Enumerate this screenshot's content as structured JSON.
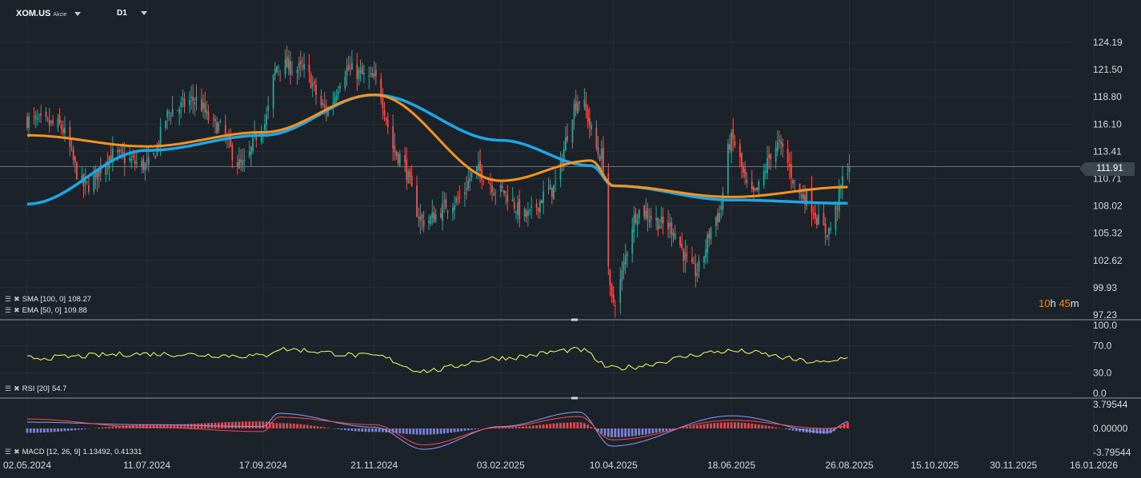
{
  "header": {
    "symbol": "XOM.US",
    "asset_type": "Akcie",
    "timeframe": "D1"
  },
  "indicators": {
    "sma_label": "SMA [100,  0]",
    "sma_value": "108.27",
    "ema_label": "EMA [50,  0]",
    "ema_value": "109.88",
    "rsi_label": "RSI [20]",
    "rsi_value": "54.7",
    "macd_label": "MACD [12,  26,  9]",
    "macd_value": "1.13492,  0.41331"
  },
  "timer": {
    "hours": "10",
    "h": "h",
    "minutes": "45",
    "m": "m"
  },
  "current_price": "111.91",
  "colors": {
    "background": "#1b2229",
    "bull": "#26a69a",
    "bear": "#ef5350",
    "sma": "#1ea7e8",
    "ema": "#f7931e",
    "rsi": "#ffff66",
    "macd_line": "#8e9cff",
    "signal_line": "#ff4b4b",
    "hist_pos": "#e0484f",
    "hist_neg": "#7b83d6"
  },
  "chart_data": {
    "type": "candlestick",
    "title": "XOM.US",
    "x_tick_labels": [
      "02.05.2024",
      "11.07.2024",
      "17.09.2024",
      "21.11.2024",
      "03.02.2025",
      "10.04.2025",
      "18.06.2025",
      "26.08.2025",
      "15.10.2025",
      "30.11.2025",
      "16.01.2026"
    ],
    "price_axis": {
      "tick_labels": [
        "124.19",
        "121.50",
        "118.80",
        "116.10",
        "113.41",
        "110.71",
        "108.02",
        "105.32",
        "102.62",
        "99.93",
        "97.23"
      ],
      "range": [
        97.23,
        125.5
      ]
    },
    "price_key_points": [
      {
        "date": "02.05.2024",
        "close": 116.5
      },
      {
        "date": "20.05.2024",
        "close": 116.0
      },
      {
        "date": "05.06.2024",
        "close": 110.0
      },
      {
        "date": "21.06.2024",
        "close": 113.0
      },
      {
        "date": "11.07.2024",
        "close": 112.0
      },
      {
        "date": "26.07.2024",
        "close": 117.5
      },
      {
        "date": "08.08.2024",
        "close": 118.5
      },
      {
        "date": "20.08.2024",
        "close": 116.0
      },
      {
        "date": "05.09.2024",
        "close": 112.0
      },
      {
        "date": "17.09.2024",
        "close": 116.0
      },
      {
        "date": "26.09.2024",
        "close": 122.0
      },
      {
        "date": "10.10.2024",
        "close": 121.5
      },
      {
        "date": "24.10.2024",
        "close": 117.5
      },
      {
        "date": "05.11.2024",
        "close": 121.5
      },
      {
        "date": "21.11.2024",
        "close": 120.5
      },
      {
        "date": "05.12.2024",
        "close": 113.0
      },
      {
        "date": "20.12.2024",
        "close": 106.5
      },
      {
        "date": "08.01.2025",
        "close": 108.5
      },
      {
        "date": "20.01.2025",
        "close": 111.5
      },
      {
        "date": "03.02.2025",
        "close": 109.5
      },
      {
        "date": "18.02.2025",
        "close": 107.0
      },
      {
        "date": "04.03.2025",
        "close": 109.5
      },
      {
        "date": "21.03.2025",
        "close": 118.5
      },
      {
        "date": "03.04.2025",
        "close": 113.0
      },
      {
        "date": "09.04.2025",
        "close": 98.5
      },
      {
        "date": "25.04.2025",
        "close": 107.5
      },
      {
        "date": "12.05.2025",
        "close": 106.0
      },
      {
        "date": "28.05.2025",
        "close": 101.5
      },
      {
        "date": "10.06.2025",
        "close": 107.0
      },
      {
        "date": "18.06.2025",
        "close": 114.5
      },
      {
        "date": "30.06.2025",
        "close": 109.0
      },
      {
        "date": "15.07.2025",
        "close": 114.0
      },
      {
        "date": "30.07.2025",
        "close": 109.0
      },
      {
        "date": "13.08.2025",
        "close": 105.5
      },
      {
        "date": "26.08.2025",
        "close": 111.91
      }
    ],
    "sma_100": [
      {
        "date": "02.05.2024",
        "value": 108.2
      },
      {
        "date": "11.07.2024",
        "value": 113.5
      },
      {
        "date": "17.09.2024",
        "value": 115.0
      },
      {
        "date": "21.11.2024",
        "value": 119.0
      },
      {
        "date": "03.02.2025",
        "value": 114.5
      },
      {
        "date": "28.03.2025",
        "value": 112.0
      },
      {
        "date": "10.04.2025",
        "value": 110.0
      },
      {
        "date": "18.06.2025",
        "value": 108.6
      },
      {
        "date": "26.08.2025",
        "value": 108.27
      }
    ],
    "ema_50": [
      {
        "date": "02.05.2024",
        "value": 115.0
      },
      {
        "date": "11.07.2024",
        "value": 113.9
      },
      {
        "date": "17.09.2024",
        "value": 115.3
      },
      {
        "date": "21.11.2024",
        "value": 119.0
      },
      {
        "date": "03.02.2025",
        "value": 110.5
      },
      {
        "date": "28.03.2025",
        "value": 112.5
      },
      {
        "date": "10.04.2025",
        "value": 110.0
      },
      {
        "date": "18.06.2025",
        "value": 108.9
      },
      {
        "date": "26.08.2025",
        "value": 109.88
      }
    ],
    "rsi": {
      "period": 20,
      "last": 54.7,
      "tick_labels": [
        "100.0",
        "70.0",
        "30.0",
        "0.0"
      ],
      "key_points": [
        {
          "date": "02.05.2024",
          "value": 52
        },
        {
          "date": "11.07.2024",
          "value": 58
        },
        {
          "date": "17.09.2024",
          "value": 55
        },
        {
          "date": "26.09.2024",
          "value": 65
        },
        {
          "date": "21.11.2024",
          "value": 55
        },
        {
          "date": "20.12.2024",
          "value": 33
        },
        {
          "date": "03.02.2025",
          "value": 52
        },
        {
          "date": "21.03.2025",
          "value": 64
        },
        {
          "date": "09.04.2025",
          "value": 37
        },
        {
          "date": "18.06.2025",
          "value": 62
        },
        {
          "date": "13.08.2025",
          "value": 45
        },
        {
          "date": "26.08.2025",
          "value": 54.7
        }
      ]
    },
    "macd": {
      "params": [
        12,
        26,
        9
      ],
      "macd_last": 1.13492,
      "signal_last": 0.41331,
      "tick_labels": [
        "3.79544",
        "0.00000",
        "-3.79544"
      ],
      "key_points": [
        {
          "date": "02.05.2024",
          "macd": 1.0,
          "signal": 1.5
        },
        {
          "date": "11.07.2024",
          "macd": 0.6,
          "signal": 0.2
        },
        {
          "date": "17.09.2024",
          "macd": 0.3,
          "signal": -0.5
        },
        {
          "date": "26.09.2024",
          "macd": 2.4,
          "signal": 1.8
        },
        {
          "date": "21.11.2024",
          "macd": 0.2,
          "signal": 0.6
        },
        {
          "date": "20.12.2024",
          "macd": -3.3,
          "signal": -2.6
        },
        {
          "date": "03.02.2025",
          "macd": 0.3,
          "signal": 0.2
        },
        {
          "date": "21.03.2025",
          "macd": 2.6,
          "signal": 1.9
        },
        {
          "date": "09.04.2025",
          "macd": -2.8,
          "signal": -1.8
        },
        {
          "date": "18.06.2025",
          "macd": 2.0,
          "signal": 1.3
        },
        {
          "date": "13.08.2025",
          "macd": -0.6,
          "signal": 0.0
        },
        {
          "date": "26.08.2025",
          "macd": 1.13492,
          "signal": 0.41331
        }
      ]
    },
    "grid": true
  }
}
